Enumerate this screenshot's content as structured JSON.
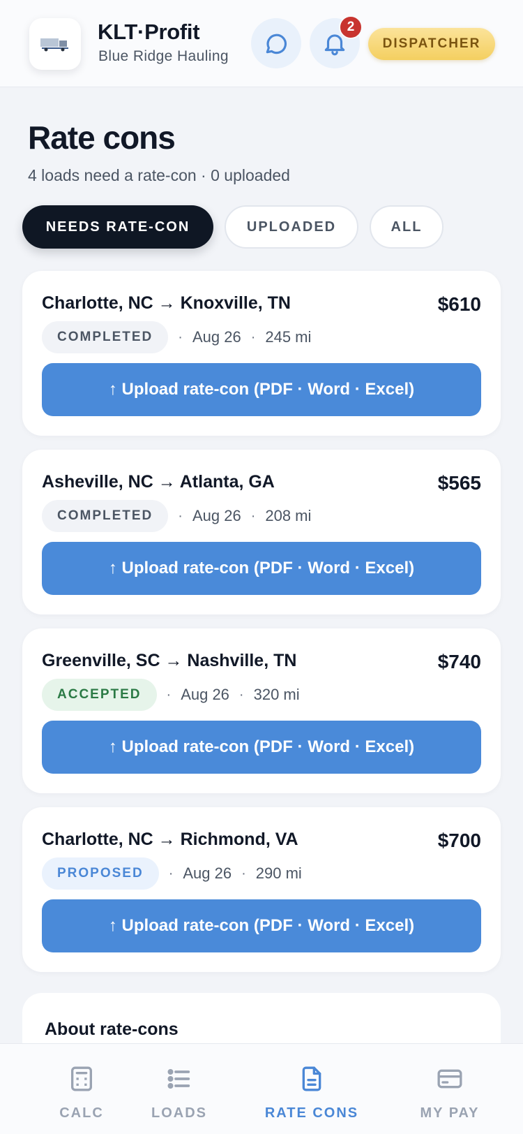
{
  "header": {
    "brand_title": "KLT·Profit",
    "brand_subtitle": "Blue Ridge Hauling",
    "notification_count": "2",
    "role_label": "DISPATCHER"
  },
  "page": {
    "title": "Rate cons",
    "subtitle": "4 loads need a rate-con · 0 uploaded"
  },
  "filters": [
    {
      "label": "NEEDS RATE-CON",
      "active": true
    },
    {
      "label": "UPLOADED",
      "active": false
    },
    {
      "label": "ALL",
      "active": false
    }
  ],
  "loads": [
    {
      "route": "Charlotte, NC → Knoxville, TN",
      "price": "$610",
      "status": "COMPLETED",
      "date": "Aug 26",
      "distance": "245 mi",
      "upload_label": "↑ Upload rate-con (PDF · Word · Excel)"
    },
    {
      "route": "Asheville, NC → Atlanta, GA",
      "price": "$565",
      "status": "COMPLETED",
      "date": "Aug 26",
      "distance": "208 mi",
      "upload_label": "↑ Upload rate-con (PDF · Word · Excel)"
    },
    {
      "route": "Greenville, SC → Nashville, TN",
      "price": "$740",
      "status": "ACCEPTED",
      "date": "Aug 26",
      "distance": "320 mi",
      "upload_label": "↑ Upload rate-con (PDF · Word · Excel)"
    },
    {
      "route": "Charlotte, NC → Richmond, VA",
      "price": "$700",
      "status": "PROPOSED",
      "date": "Aug 26",
      "distance": "290 mi",
      "upload_label": "↑ Upload rate-con (PDF · Word · Excel)"
    }
  ],
  "about": {
    "title": "About rate-cons"
  },
  "nav": {
    "items": [
      {
        "label": "CALC",
        "icon": "calculator-icon",
        "active": false
      },
      {
        "label": "LOADS",
        "icon": "list-icon",
        "active": false
      },
      {
        "label": "RATE CONS",
        "icon": "document-icon",
        "active": true
      },
      {
        "label": "MY PAY",
        "icon": "credit-card-icon",
        "active": false
      }
    ]
  },
  "colors": {
    "accent": "#4a8ad9",
    "dark": "#0f1724",
    "badge": "#c8342f",
    "role": "#f4cf60"
  }
}
